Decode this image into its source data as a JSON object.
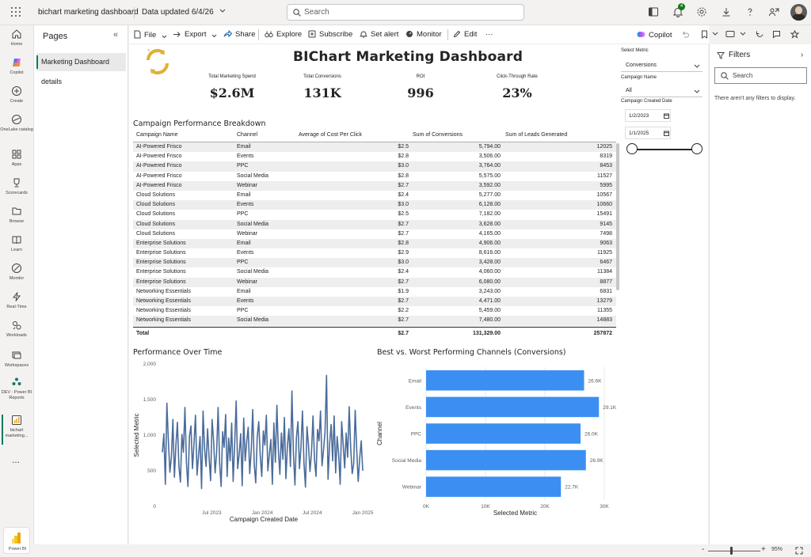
{
  "topbar": {
    "title": "bichart marketing dashboard",
    "data_updated": "Data updated 6/4/26",
    "search_placeholder": "Search",
    "notification_count": "4"
  },
  "rail": {
    "items": [
      {
        "label": "Home",
        "icon": "home-icon"
      },
      {
        "label": "Copilot",
        "icon": "copilot-icon"
      },
      {
        "label": "Create",
        "icon": "create-icon"
      },
      {
        "label": "OneLake catalog",
        "icon": "onelake-icon"
      },
      {
        "label": "Apps",
        "icon": "apps-icon"
      },
      {
        "label": "Scorecards",
        "icon": "trophy-icon"
      },
      {
        "label": "Browse",
        "icon": "folder-icon"
      },
      {
        "label": "Learn",
        "icon": "book-icon"
      },
      {
        "label": "Monitor",
        "icon": "monitor-icon"
      },
      {
        "label": "Real-Time",
        "icon": "lightning-icon"
      },
      {
        "label": "Workloads",
        "icon": "workloads-icon"
      },
      {
        "label": "Workspaces",
        "icon": "workspaces-icon"
      },
      {
        "label": "DEV - Power BI Reports",
        "icon": "workspace-group-icon"
      },
      {
        "label": "bichart marketing...",
        "icon": "report-icon"
      }
    ],
    "more": "...",
    "product": "Power BI"
  },
  "pages": {
    "title": "Pages",
    "items": [
      "Marketing Dashboard",
      "details"
    ]
  },
  "toolbar": {
    "file": "File",
    "export": "Export",
    "share": "Share",
    "explore": "Explore",
    "subscribe": "Subscribe",
    "set_alert": "Set alert",
    "monitor": "Monitor",
    "edit": "Edit",
    "more": "···",
    "copilot": "Copilot"
  },
  "dashboard": {
    "title": "BIChart Marketing Dashboard",
    "kpis": [
      {
        "label": "Total Marketing Spend",
        "value": "$2.6M"
      },
      {
        "label": "Total Conversions",
        "value": "131K"
      },
      {
        "label": "ROI",
        "value": "996"
      },
      {
        "label": "Click-Through Rate",
        "value": "23%"
      }
    ]
  },
  "table": {
    "title": "Campaign Performance Breakdown",
    "columns": [
      "Campaign Name",
      "Channel",
      "Average of Cost Per Click",
      "Sum of Conversions",
      "Sum of Leads Generated"
    ],
    "rows": [
      [
        "AI-Powered Frisco",
        "Email",
        "$2.5",
        "5,794.00",
        "12025"
      ],
      [
        "AI-Powered Frisco",
        "Events",
        "$2.8",
        "3,506.00",
        "8319"
      ],
      [
        "AI-Powered Frisco",
        "PPC",
        "$3.0",
        "3,764.00",
        "8453"
      ],
      [
        "AI-Powered Frisco",
        "Social Media",
        "$2.8",
        "5,575.00",
        "11527"
      ],
      [
        "AI-Powered Frisco",
        "Webinar",
        "$2.7",
        "3,592.00",
        "5995"
      ],
      [
        "Cloud Solutions",
        "Email",
        "$2.4",
        "5,277.00",
        "10567"
      ],
      [
        "Cloud Solutions",
        "Events",
        "$3.0",
        "6,128.00",
        "10660"
      ],
      [
        "Cloud Solutions",
        "PPC",
        "$2.5",
        "7,182.00",
        "15491"
      ],
      [
        "Cloud Solutions",
        "Social Media",
        "$2.7",
        "3,628.00",
        "9145"
      ],
      [
        "Cloud Solutions",
        "Webinar",
        "$2.7",
        "4,165.00",
        "7498"
      ],
      [
        "Enterprise Solutions",
        "Email",
        "$2.8",
        "4,906.00",
        "9063"
      ],
      [
        "Enterprise Solutions",
        "Events",
        "$2.9",
        "8,616.00",
        "11925"
      ],
      [
        "Enterprise Solutions",
        "PPC",
        "$3.0",
        "3,428.00",
        "6467"
      ],
      [
        "Enterprise Solutions",
        "Social Media",
        "$2.4",
        "4,060.00",
        "11384"
      ],
      [
        "Enterprise Solutions",
        "Webinar",
        "$2.7",
        "6,080.00",
        "8877"
      ],
      [
        "Networking Essentials",
        "Email",
        "$1.9",
        "3,243.00",
        "6831"
      ],
      [
        "Networking Essentials",
        "Events",
        "$2.7",
        "4,471.00",
        "13279"
      ],
      [
        "Networking Essentials",
        "PPC",
        "$2.2",
        "5,459.00",
        "11355"
      ],
      [
        "Networking Essentials",
        "Social Media",
        "$2.7",
        "7,480.00",
        "14883"
      ]
    ],
    "total": [
      "Total",
      "",
      "$2.7",
      "131,329.00",
      "257872"
    ]
  },
  "slicers": {
    "metric_label": "Select Metric",
    "metric_value": "Conversions",
    "campaign_label": "Campaign Name",
    "campaign_value": "All",
    "date_label": "Campaign Created Date",
    "date_start": "1/2/2023",
    "date_end": "1/1/2025"
  },
  "filters": {
    "title": "Filters",
    "search_placeholder": "Search",
    "empty_text": "There aren't any filters to display."
  },
  "statusbar": {
    "zoom_minus": "-",
    "zoom_plus": "+",
    "zoom": "95%"
  },
  "colors": {
    "accent": "#117865",
    "line": "#4a6c9b",
    "bar": "#3b8ff3"
  },
  "chart_data": [
    {
      "type": "line",
      "title": "Performance Over Time",
      "xlabel": "Campaign Created Date",
      "ylabel": "Selected Metric",
      "x_ticks": [
        "Jul 2023",
        "Jan 2024",
        "Jul 2024",
        "Jan 2025"
      ],
      "y_ticks": [
        "0",
        "500",
        "1,000",
        "1,500",
        "2,000"
      ],
      "ylim": [
        0,
        2000
      ],
      "xlim": [
        "2023-01-02",
        "2025-01-01"
      ],
      "series": [
        {
          "values": [
            760,
            1020,
            310,
            1450,
            920,
            480,
            690,
            1220,
            410,
            860,
            1180,
            560,
            340,
            1010,
            760,
            1390,
            620,
            280,
            980,
            1130,
            530,
            870,
            1280,
            440,
            720,
            980,
            250,
            1340,
            810,
            560,
            1090,
            690,
            360,
            1220,
            920,
            470,
            750,
            1390,
            610,
            280,
            1050,
            830,
            1290,
            420,
            960,
            640,
            1170,
            350,
            880,
            1480,
            530,
            730,
            1020,
            290,
            1240,
            640,
            910,
            1110,
            460,
            780,
            1360,
            590,
            330,
            980,
            1190,
            710,
            420,
            1060,
            860,
            1280,
            500,
            730,
            940,
            310,
            1170,
            620,
            1420,
            780,
            450,
            1030,
            660,
            1250,
            390,
            850,
            1090,
            560,
            1620,
            740,
            300,
            970,
            1190,
            530,
            830,
            1340,
            610,
            270,
            1120,
            860,
            490,
            760,
            1270,
            660,
            420,
            1080,
            920,
            1340,
            570,
            790,
            1050,
            1840,
            380,
            880,
            1150,
            640,
            1270,
            470,
            980,
            730,
            310,
            1190,
            870,
            540,
            1030,
            690,
            1400,
            820,
            460,
            600,
            1350,
            790,
            350,
            680,
            920,
            500
          ]
        }
      ]
    },
    {
      "type": "bar",
      "orientation": "horizontal",
      "title": "Best vs. Worst Performing Channels (Conversions)",
      "xlabel": "Selected Metric",
      "ylabel": "Channel",
      "categories": [
        "Email",
        "Events",
        "PPC",
        "Social Media",
        "Webinar"
      ],
      "values": [
        26600,
        29100,
        26000,
        26900,
        22700
      ],
      "data_labels": [
        "26.6K",
        "29.1K",
        "26.0K",
        "26.9K",
        "22.7K"
      ],
      "x_ticks": [
        "0K",
        "10K",
        "20K",
        "30K"
      ],
      "xlim": [
        0,
        30000
      ]
    }
  ]
}
